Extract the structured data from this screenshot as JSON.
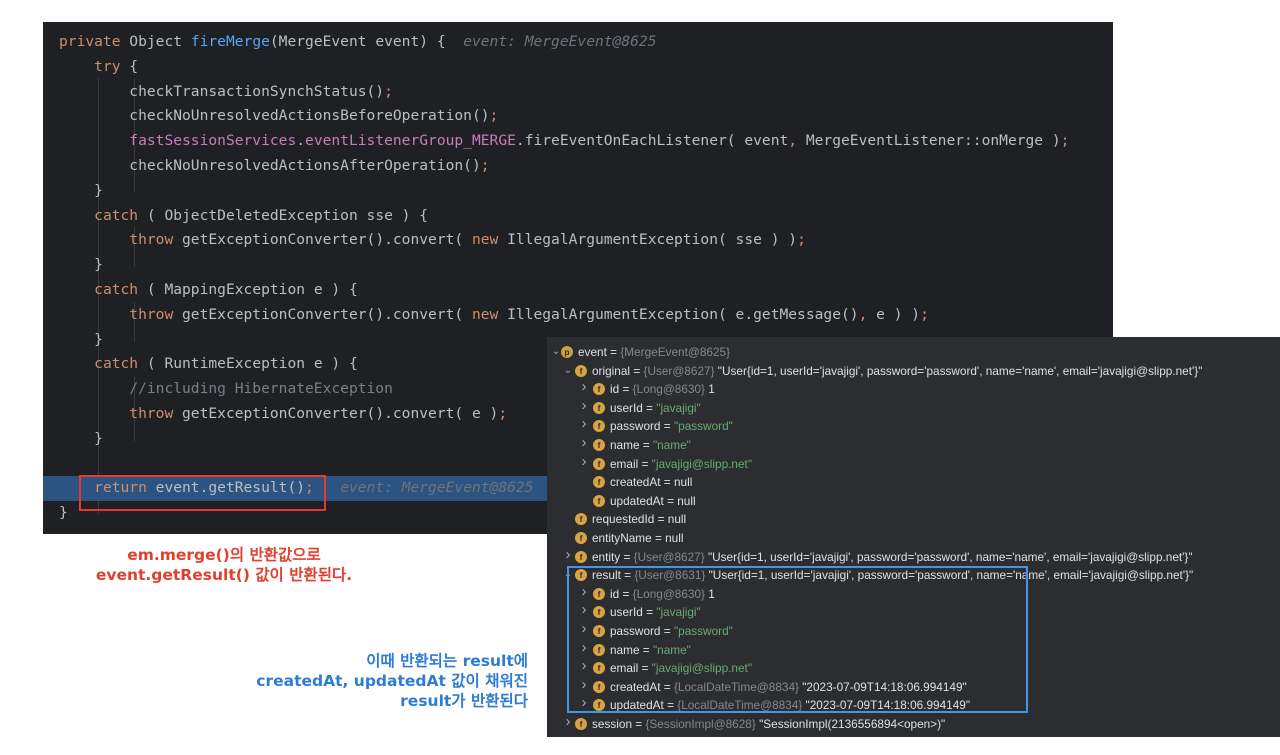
{
  "code": {
    "lines": [
      [
        {
          "t": "private ",
          "c": "kw"
        },
        {
          "t": "Object "
        },
        {
          "t": "fireMerge",
          "c": "fn"
        },
        {
          "t": "(MergeEvent event) {  "
        },
        {
          "t": "event: MergeEvent@8625",
          "c": "hint"
        }
      ],
      [
        {
          "t": "    "
        },
        {
          "t": "try",
          "c": "kw"
        },
        {
          "t": " {"
        }
      ],
      [
        {
          "t": "        checkTransactionSynchStatus()"
        },
        {
          "t": ";",
          "c": "kw"
        }
      ],
      [
        {
          "t": "        checkNoUnresolvedActionsBeforeOperation()"
        },
        {
          "t": ";",
          "c": "kw"
        }
      ],
      [
        {
          "t": "        "
        },
        {
          "t": "fastSessionServices",
          "c": "fld"
        },
        {
          "t": "."
        },
        {
          "t": "eventListenerGroup_MERGE",
          "c": "fld"
        },
        {
          "t": ".fireEventOnEachListener( event"
        },
        {
          "t": ",",
          "c": "kw"
        },
        {
          "t": " MergeEventListener::onMerge )"
        },
        {
          "t": ";",
          "c": "kw"
        }
      ],
      [
        {
          "t": "        checkNoUnresolvedActionsAfterOperation()"
        },
        {
          "t": ";",
          "c": "kw"
        }
      ],
      [
        {
          "t": "    }"
        }
      ],
      [
        {
          "t": "    "
        },
        {
          "t": "catch",
          "c": "kw"
        },
        {
          "t": " ( ObjectDeletedException sse ) {"
        }
      ],
      [
        {
          "t": "        "
        },
        {
          "t": "throw",
          "c": "kw"
        },
        {
          "t": " getExceptionConverter().convert( "
        },
        {
          "t": "new",
          "c": "kw"
        },
        {
          "t": " IllegalArgumentException( sse ) )"
        },
        {
          "t": ";",
          "c": "kw"
        }
      ],
      [
        {
          "t": "    }"
        }
      ],
      [
        {
          "t": "    "
        },
        {
          "t": "catch",
          "c": "kw"
        },
        {
          "t": " ( MappingException e ) {"
        }
      ],
      [
        {
          "t": "        "
        },
        {
          "t": "throw",
          "c": "kw"
        },
        {
          "t": " getExceptionConverter().convert( "
        },
        {
          "t": "new",
          "c": "kw"
        },
        {
          "t": " IllegalArgumentException( e.getMessage()"
        },
        {
          "t": ",",
          "c": "kw"
        },
        {
          "t": " e ) )"
        },
        {
          "t": ";",
          "c": "kw"
        }
      ],
      [
        {
          "t": "    }"
        }
      ],
      [
        {
          "t": "    "
        },
        {
          "t": "catch",
          "c": "kw"
        },
        {
          "t": " ( RuntimeException e ) {"
        }
      ],
      [
        {
          "t": "        "
        },
        {
          "t": "//including HibernateException",
          "c": "cm"
        }
      ],
      [
        {
          "t": "        "
        },
        {
          "t": "throw",
          "c": "kw"
        },
        {
          "t": " getExceptionConverter().convert( e )"
        },
        {
          "t": ";",
          "c": "kw"
        }
      ],
      [
        {
          "t": "    }"
        }
      ],
      [
        {
          "t": ""
        }
      ],
      [
        {
          "t": "    "
        },
        {
          "t": "return",
          "c": "kw"
        },
        {
          "t": " event.getResult()"
        },
        {
          "t": ";",
          "c": "kw"
        },
        {
          "t": "   "
        },
        {
          "t": "event: MergeEvent@8625",
          "c": "hint"
        }
      ],
      [
        {
          "t": "}"
        }
      ]
    ],
    "highlighted_line": 18
  },
  "annotation_red": "em.merge()의 반환값으로\nevent.getResult() 값이 반환된다.",
  "annotation_blue": "이때 반환되는 result에\ncreatedAt, updatedAt 값이 채워진\nresult가 반환된다",
  "debugger": {
    "rows": [
      {
        "depth": 0,
        "arrow": "expanded",
        "badge": "p",
        "name": "event",
        "type": "{MergeEvent@8625}",
        "value": ""
      },
      {
        "depth": 1,
        "arrow": "expanded",
        "badge": "f",
        "name": "original",
        "type": "{User@8627}",
        "value": "\"User{id=1, userId='javajigi', password='password', name='name', email='javajigi@slipp.net'}\""
      },
      {
        "depth": 2,
        "arrow": "collapsed",
        "badge": "f",
        "name": "id",
        "type": "{Long@8630}",
        "value": "1"
      },
      {
        "depth": 2,
        "arrow": "collapsed",
        "badge": "f",
        "name": "userId",
        "type": "",
        "value": "\"javajigi\"",
        "str": true
      },
      {
        "depth": 2,
        "arrow": "collapsed",
        "badge": "f",
        "name": "password",
        "type": "",
        "value": "\"password\"",
        "str": true
      },
      {
        "depth": 2,
        "arrow": "collapsed",
        "badge": "f",
        "name": "name",
        "type": "",
        "value": "\"name\"",
        "str": true
      },
      {
        "depth": 2,
        "arrow": "collapsed",
        "badge": "f",
        "name": "email",
        "type": "",
        "value": "\"javajigi@slipp.net\"",
        "str": true
      },
      {
        "depth": 2,
        "arrow": "none",
        "badge": "f",
        "name": "createdAt",
        "type": "",
        "value": "null"
      },
      {
        "depth": 2,
        "arrow": "none",
        "badge": "f",
        "name": "updatedAt",
        "type": "",
        "value": "null"
      },
      {
        "depth": 1,
        "arrow": "none",
        "badge": "f",
        "name": "requestedId",
        "type": "",
        "value": "null"
      },
      {
        "depth": 1,
        "arrow": "none",
        "badge": "f",
        "name": "entityName",
        "type": "",
        "value": "null"
      },
      {
        "depth": 1,
        "arrow": "collapsed",
        "badge": "f",
        "name": "entity",
        "type": "{User@8627}",
        "value": "\"User{id=1, userId='javajigi', password='password', name='name', email='javajigi@slipp.net'}\""
      },
      {
        "depth": 1,
        "arrow": "expanded",
        "badge": "f",
        "name": "result",
        "type": "{User@8631}",
        "value": "\"User{id=1, userId='javajigi', password='password', name='name', email='javajigi@slipp.net'}\""
      },
      {
        "depth": 2,
        "arrow": "collapsed",
        "badge": "f",
        "name": "id",
        "type": "{Long@8630}",
        "value": "1"
      },
      {
        "depth": 2,
        "arrow": "collapsed",
        "badge": "f",
        "name": "userId",
        "type": "",
        "value": "\"javajigi\"",
        "str": true
      },
      {
        "depth": 2,
        "arrow": "collapsed",
        "badge": "f",
        "name": "password",
        "type": "",
        "value": "\"password\"",
        "str": true
      },
      {
        "depth": 2,
        "arrow": "collapsed",
        "badge": "f",
        "name": "name",
        "type": "",
        "value": "\"name\"",
        "str": true
      },
      {
        "depth": 2,
        "arrow": "collapsed",
        "badge": "f",
        "name": "email",
        "type": "",
        "value": "\"javajigi@slipp.net\"",
        "str": true
      },
      {
        "depth": 2,
        "arrow": "collapsed",
        "badge": "f",
        "name": "createdAt",
        "type": "{LocalDateTime@8834}",
        "value": "\"2023-07-09T14:18:06.994149\""
      },
      {
        "depth": 2,
        "arrow": "collapsed",
        "badge": "f",
        "name": "updatedAt",
        "type": "{LocalDateTime@8834}",
        "value": "\"2023-07-09T14:18:06.994149\""
      },
      {
        "depth": 1,
        "arrow": "collapsed",
        "badge": "f",
        "name": "session",
        "type": "{SessionImpl@8628}",
        "value": "\"SessionImpl(2136556894<open>)\""
      }
    ]
  }
}
